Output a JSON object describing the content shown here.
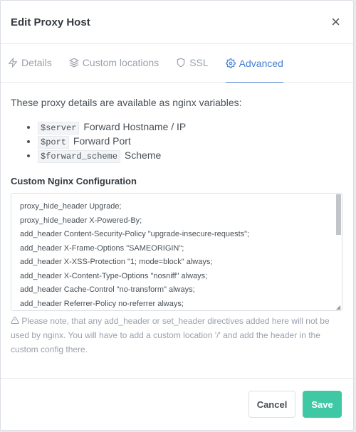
{
  "modal": {
    "title": "Edit Proxy Host",
    "close_symbol": "×"
  },
  "tabs": [
    {
      "label": "Details",
      "icon": "zap-icon"
    },
    {
      "label": "Custom locations",
      "icon": "layers-icon"
    },
    {
      "label": "SSL",
      "icon": "shield-icon"
    },
    {
      "label": "Advanced",
      "icon": "gear-icon",
      "active": true
    }
  ],
  "advanced": {
    "intro": "These proxy details are available as nginx variables:",
    "variables": [
      {
        "code": "$server",
        "desc": "Forward Hostname / IP"
      },
      {
        "code": "$port",
        "desc": "Forward Port"
      },
      {
        "code": "$forward_scheme",
        "desc": "Scheme"
      }
    ],
    "config_label": "Custom Nginx Configuration",
    "config_lines": [
      "proxy_hide_header Upgrade;",
      "proxy_hide_header X-Powered-By;",
      "add_header Content-Security-Policy \"upgrade-insecure-requests\";",
      "add_header X-Frame-Options \"SAMEORIGIN\";",
      "add_header X-XSS-Protection \"1; mode=block\" always;",
      "add_header X-Content-Type-Options \"nosniff\" always;",
      "add_header Cache-Control \"no-transform\" always;",
      "add_header Referrer-Policy no-referrer always;"
    ],
    "note": "Please note, that any add_header or set_header directives added here will not be used by nginx. You will have to add a custom location '/' and add the header in the custom config there."
  },
  "footer": {
    "cancel_label": "Cancel",
    "save_label": "Save"
  },
  "colors": {
    "accent": "#467fcf",
    "save_button": "#3ec9a4"
  }
}
